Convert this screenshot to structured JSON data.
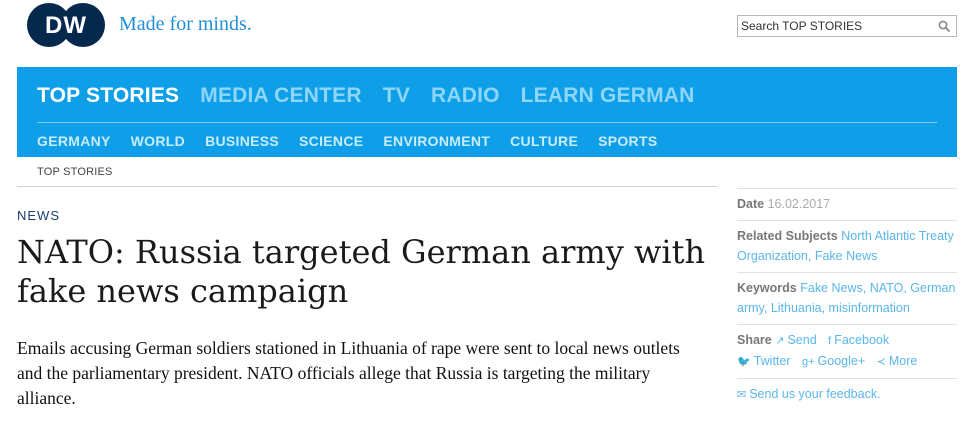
{
  "header": {
    "logo_text": "DW",
    "tagline": "Made for minds.",
    "search_placeholder": "Search TOP STORIES"
  },
  "nav": {
    "main": [
      {
        "label": "TOP STORIES",
        "active": true
      },
      {
        "label": "MEDIA CENTER",
        "active": false
      },
      {
        "label": "TV",
        "active": false
      },
      {
        "label": "RADIO",
        "active": false
      },
      {
        "label": "LEARN GERMAN",
        "active": false
      }
    ],
    "sub": [
      "GERMANY",
      "WORLD",
      "BUSINESS",
      "SCIENCE",
      "ENVIRONMENT",
      "CULTURE",
      "SPORTS"
    ]
  },
  "breadcrumb": "TOP STORIES",
  "article": {
    "kicker": "NEWS",
    "headline": "NATO: Russia targeted German army with fake news campaign",
    "teaser": "Emails accusing German soldiers stationed in Lithuania of rape were sent to local news outlets and the parliamentary president. NATO officials allege that Russia is targeting the military alliance."
  },
  "sidebar": {
    "date_label": "Date",
    "date_value": "16.02.2017",
    "related_label": "Related Subjects",
    "related_links": [
      "North Atlantic Treaty Organization",
      "Fake News"
    ],
    "keywords_label": "Keywords",
    "keywords": [
      "Fake News",
      "NATO",
      "German army",
      "Lithuania",
      "misinformation"
    ],
    "share_label": "Share",
    "share_items": [
      {
        "icon": "send-icon",
        "glyph": "↗",
        "label": "Send"
      },
      {
        "icon": "facebook-icon",
        "glyph": "f",
        "label": "Facebook"
      },
      {
        "icon": "twitter-icon",
        "glyph": "🐦",
        "label": "Twitter"
      },
      {
        "icon": "google-plus-icon",
        "glyph": "g+",
        "label": "Google+"
      },
      {
        "icon": "more-icon",
        "glyph": "≺",
        "label": "More"
      }
    ],
    "feedback_label": "Send us your feedback."
  },
  "colors": {
    "brand_blue": "#0f9fe8",
    "logo_navy": "#05284d",
    "link_blue": "#5ab6ea",
    "kicker_navy": "#1a3b6e"
  }
}
